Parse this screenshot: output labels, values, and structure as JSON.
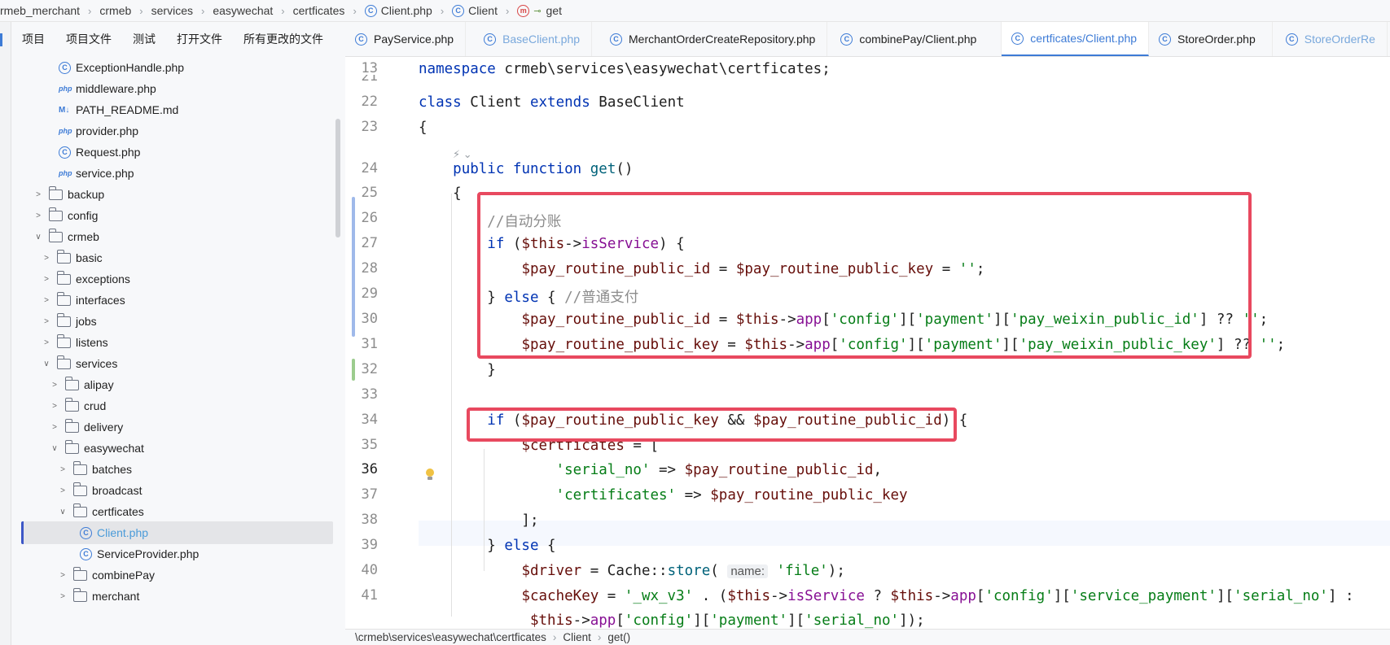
{
  "breadcrumb": {
    "items": [
      "rmeb_merchant",
      "crmeb",
      "services",
      "easywechat",
      "certficates",
      "Client.php",
      "Client",
      "get"
    ]
  },
  "project_tabs": [
    "项目",
    "项目文件",
    "测试",
    "打开文件",
    "所有更改的文件"
  ],
  "tree": {
    "rows": [
      {
        "label": "ExceptionHandle.php",
        "icon": "class-icon"
      },
      {
        "label": "middleware.php",
        "icon": "php-icon"
      },
      {
        "label": "PATH_README.md",
        "icon": "markdown-icon"
      },
      {
        "label": "provider.php",
        "icon": "php-icon"
      },
      {
        "label": "Request.php",
        "icon": "class-icon"
      },
      {
        "label": "service.php",
        "icon": "php-icon"
      },
      {
        "label": "backup",
        "icon": "folder-icon"
      },
      {
        "label": "config",
        "icon": "folder-icon"
      },
      {
        "label": "crmeb",
        "icon": "folder-icon"
      },
      {
        "label": "basic",
        "icon": "folder-icon"
      },
      {
        "label": "exceptions",
        "icon": "folder-icon"
      },
      {
        "label": "interfaces",
        "icon": "folder-icon"
      },
      {
        "label": "jobs",
        "icon": "folder-icon"
      },
      {
        "label": "listens",
        "icon": "folder-icon"
      },
      {
        "label": "services",
        "icon": "folder-icon"
      },
      {
        "label": "alipay",
        "icon": "folder-icon"
      },
      {
        "label": "crud",
        "icon": "folder-icon"
      },
      {
        "label": "delivery",
        "icon": "folder-icon"
      },
      {
        "label": "easywechat",
        "icon": "folder-icon"
      },
      {
        "label": "batches",
        "icon": "folder-icon"
      },
      {
        "label": "broadcast",
        "icon": "folder-icon"
      },
      {
        "label": "certficates",
        "icon": "folder-icon"
      },
      {
        "label": "Client.php",
        "icon": "class-icon"
      },
      {
        "label": "ServiceProvider.php",
        "icon": "class-icon"
      },
      {
        "label": "combinePay",
        "icon": "folder-icon"
      },
      {
        "label": "merchant",
        "icon": "folder-icon"
      }
    ]
  },
  "editor_tabs": [
    {
      "label": "PayService.php",
      "icon": "class-icon"
    },
    {
      "label": "BaseClient.php",
      "icon": "class-icon"
    },
    {
      "label": "MerchantOrderCreateRepository.php",
      "icon": "class-icon"
    },
    {
      "label": "combinePay/Client.php",
      "icon": "class-icon"
    },
    {
      "label": "certficates/Client.php",
      "icon": "class-icon"
    },
    {
      "label": "StoreOrder.php",
      "icon": "class-icon"
    },
    {
      "label": "StoreOrderRe",
      "icon": "class-icon"
    }
  ],
  "code": {
    "line_numbers": [
      "13",
      "21",
      "22",
      "23",
      "24",
      "25",
      "26",
      "27",
      "28",
      "29",
      "30",
      "31",
      "32",
      "33",
      "34",
      "35",
      "36",
      "37",
      "38",
      "39",
      "40",
      "41"
    ],
    "current_line": "36",
    "comment_auto_split": "//自动分账",
    "comment_normal_pay": "//普通支付",
    "param_hint": "name:"
  },
  "status_bar": {
    "path": [
      "\\crmeb\\services\\easywechat\\certficates",
      "Client",
      "get()"
    ]
  },
  "colors": {
    "accent": "#3d7bd6",
    "highlight_box": "#e8495f",
    "keyword": "#0033b3",
    "string": "#067d17"
  }
}
